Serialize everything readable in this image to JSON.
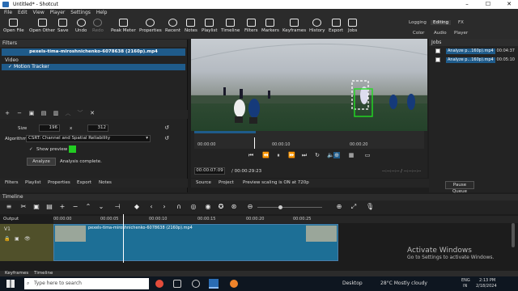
{
  "window": {
    "title": "Untitled* - Shotcut",
    "minimize": "–",
    "maximize": "☐",
    "close": "✕"
  },
  "menu": [
    "File",
    "Edit",
    "View",
    "Player",
    "Settings",
    "Help"
  ],
  "toolbar": {
    "buttons": [
      "Open File",
      "Open Other",
      "Save",
      "Undo",
      "Redo",
      "Peak Meter",
      "Properties",
      "Recent",
      "Notes",
      "Playlist",
      "Timeline",
      "Filters",
      "Markers",
      "Keyframes",
      "History",
      "Export",
      "Jobs"
    ],
    "layouts_top": [
      "Logging",
      "Editing",
      "FX"
    ],
    "layouts_bottom": [
      "Color",
      "Audio",
      "Player"
    ]
  },
  "filters": {
    "panel_title": "Filters",
    "selected_clip": "pexels-tima-miroshnichenko-6078638 (2160p).mp4",
    "group": "Video",
    "filter_name": "Motion Tracker",
    "size_label": "Size",
    "size_w": "196",
    "size_x": "x",
    "size_h": "312",
    "algorithm_label": "Algorithm",
    "algorithm_value": "CSRT: Channel and Spatial Reliability",
    "show_preview_label": "Show preview",
    "preview_color": "#22cc22",
    "analyze_label": "Analyze",
    "status_text": "Analysis complete."
  },
  "left_tabs": [
    "Filters",
    "Playlist",
    "Properties",
    "Export",
    "Notes"
  ],
  "viewer": {
    "ruler": [
      "00:00:00",
      "00:00:10",
      "00:00:20"
    ],
    "timecode": "00:00:07:09",
    "duration": "/ 00:00:29:23",
    "in_out": "--:--:--:-- / --:--:--:--",
    "tabs": [
      "Source",
      "Project"
    ],
    "scaling_notice": "Preview scaling is ON at 720p"
  },
  "jobs": {
    "title": "Jobs",
    "items": [
      {
        "name": "Analyze p...160p).mp4",
        "time": "00:04:37"
      },
      {
        "name": "Analyze p...160p).mp4",
        "time": "00:05:10"
      }
    ],
    "pause_label": "Pause Queue"
  },
  "timeline": {
    "title": "Timeline",
    "output_label": "Output",
    "track_label": "V1",
    "clip_label": "pexels-tima-miroshnichenko-6078638 (2160p).mp4",
    "ruler": [
      "00:00:00",
      "00:00:05",
      "00:00:10",
      "00:00:15",
      "00:00:20",
      "00:00:25"
    ]
  },
  "bottom_tabs": [
    "Keyframes",
    "Timeline"
  ],
  "activate": {
    "line1": "Activate Windows",
    "line2": "Go to Settings to activate Windows."
  },
  "taskbar": {
    "search_placeholder": "Type here to search",
    "desktop": "Desktop",
    "weather": "28°C  Mostly cloudy",
    "lang1": "ENG",
    "lang2": "IN",
    "time": "2:13 PM",
    "date": "2/18/2024"
  }
}
